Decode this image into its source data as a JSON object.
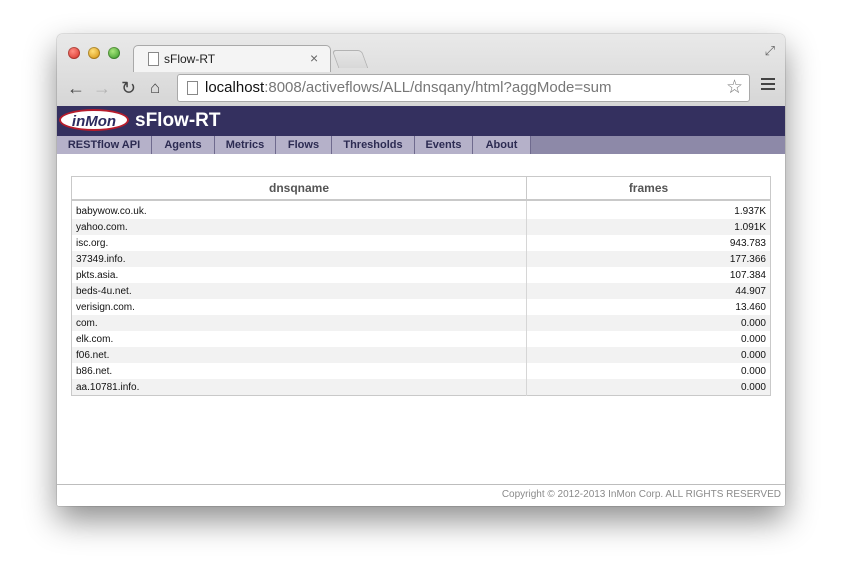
{
  "browser": {
    "tab_title": "sFlow-RT",
    "tab_close": "×",
    "url_host": "localhost",
    "url_rest": ":8008/activeflows/ALL/dnsqany/html?aggMode=sum",
    "icons": [
      "back-icon",
      "forward-icon",
      "reload-icon",
      "home-icon",
      "page-icon",
      "star-icon",
      "menu-icon",
      "fullscreen-icon"
    ]
  },
  "header": {
    "logo": "inMon",
    "title": "sFlow-RT"
  },
  "nav": {
    "items": [
      "RESTflow API",
      "Agents",
      "Metrics",
      "Flows",
      "Thresholds",
      "Events",
      "About"
    ]
  },
  "table": {
    "columns": [
      "dnsqname",
      "frames"
    ],
    "rows": [
      [
        "babywow.co.uk.",
        "1.937K"
      ],
      [
        "yahoo.com.",
        "1.091K"
      ],
      [
        "isc.org.",
        "943.783"
      ],
      [
        "37349.info.",
        "177.366"
      ],
      [
        "pkts.asia.",
        "107.384"
      ],
      [
        "beds-4u.net.",
        "44.907"
      ],
      [
        "verisign.com.",
        "13.460"
      ],
      [
        "com.",
        "0.000"
      ],
      [
        "elk.com.",
        "0.000"
      ],
      [
        "f06.net.",
        "0.000"
      ],
      [
        "b86.net.",
        "0.000"
      ],
      [
        "aa.10781.info.",
        "0.000"
      ]
    ]
  },
  "footer": {
    "copyright": "Copyright © 2012-2013 InMon Corp. ALL RIGHTS RESERVED"
  },
  "colors": {
    "header_bg": "#34305f",
    "nav_bg": "#b5b1c9",
    "logo_ring": "#b71c2c"
  }
}
